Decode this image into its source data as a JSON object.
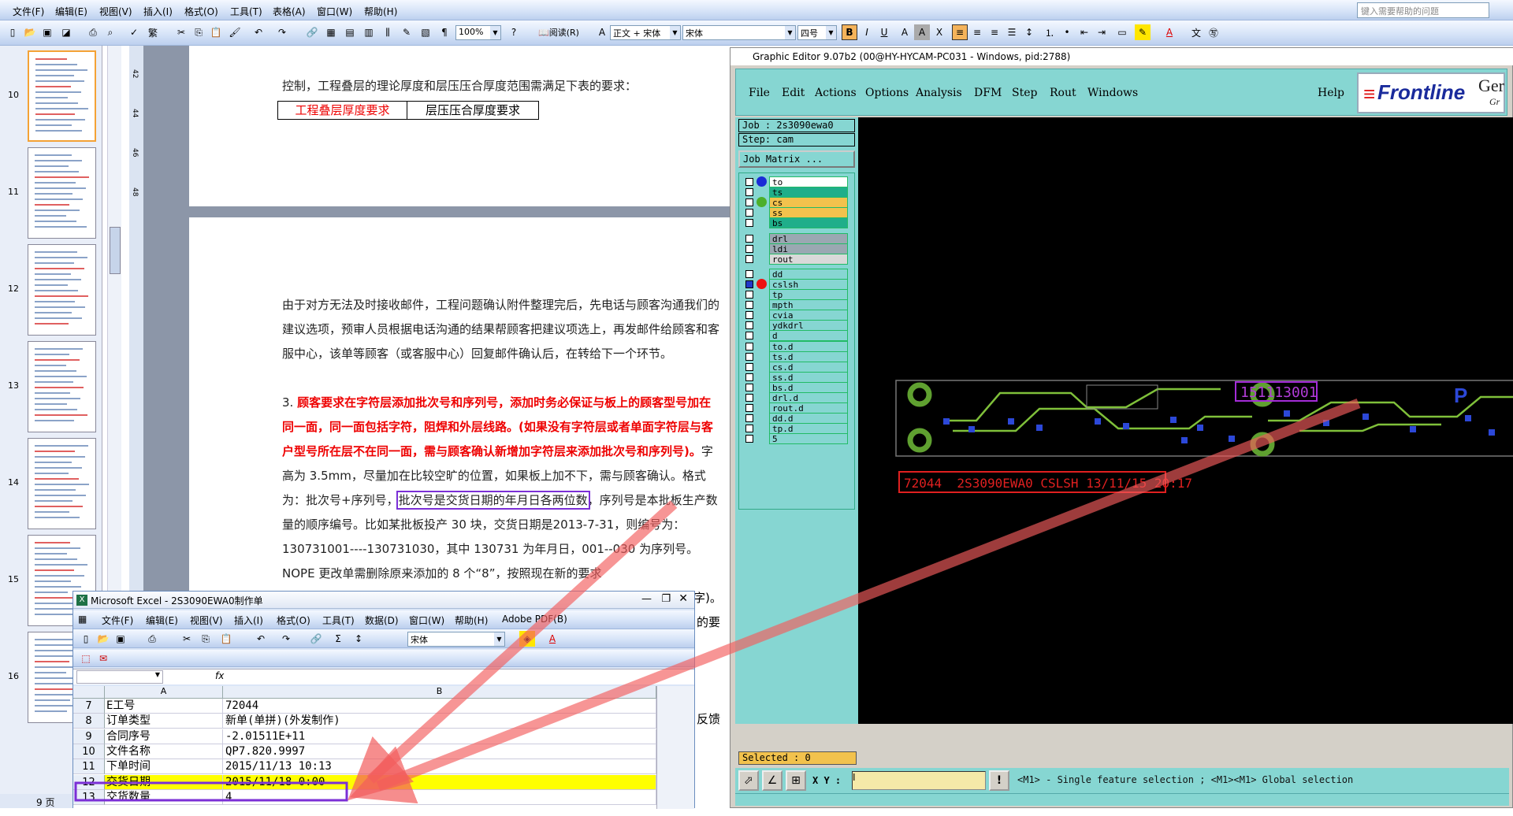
{
  "word": {
    "menu": [
      "文件(F)",
      "编辑(E)",
      "视图(V)",
      "插入(I)",
      "格式(O)",
      "工具(T)",
      "表格(A)",
      "窗口(W)",
      "帮助(H)"
    ],
    "ask_placeholder": "键入需要帮助的问题",
    "zoom": "100%",
    "read_label": "阅读(R)",
    "style": "正文 + 宋体",
    "font": "宋体",
    "size": "四号",
    "page_numbers": [
      "10",
      "11",
      "12",
      "13",
      "14",
      "15",
      "16"
    ],
    "status_pages": "9 页",
    "ruler_marks": [
      "42",
      "44",
      "46",
      "48"
    ],
    "table_left": "工程叠层厚度要求",
    "table_right": "层压压合厚度要求",
    "line_top": "控制，工程叠层的理论厚度和层压压合厚度范围需满足下表的要求：",
    "para1": "由于对方无法及时接收邮件，工程问题确认附件整理完后，先电话与顾客沟通我们的建议选项，预审人员根据电话沟通的结果帮顾客把建议项选上，再发邮件给顾客和客服中心，该单等顾客（或客服中心）回复邮件确认后，在转给下一个环节。",
    "item3_num": "3.",
    "item3_red": "顾客要求在字符层添加批次号和序列号，添加时务必保证与板上的顾客型号加在同一面，同一面包括字符，阻焊和外层线路。(如果没有字符层或者单面字符层与客户型号所在层不在同一面，需与顾客确认新增加字符层来添加批次号和序列号)。",
    "item3_rest_a": "字高为 3.5mm，尽量加在比较空旷的位置，如果板上加不下，需与顾客确认。格式为：批次号+序列号，",
    "item3_boxed": "批次号是交货日期的年月日各两位数",
    "item3_rest_b": "，序列号是本批板生产数量的顺序编号。比如某批板投产 30 块，交货日期是2013-7-31，则编号为：130731001----130731030，其中 130731 为年月日，001--030 为序列号。NOPE 更改单需删除原来添加的 8 个“8”，按照现在新的要求",
    "right_fragments": [
      "字)。",
      "的要",
      "反馈"
    ]
  },
  "genesis": {
    "title": "Graphic Editor 9.07b2 (00@HY-HYCAM-PC031 - Windows, pid:2788)",
    "menu": [
      "File",
      "Edit",
      "Actions",
      "Options",
      "Analysis",
      "DFM",
      "Step",
      "Rout",
      "Windows"
    ],
    "help": "Help",
    "logo": "Frontline",
    "logo_tail": "Ger",
    "logo_sub": "Gr",
    "job": "Job : 2s3090ewa0",
    "step": "Step: cam",
    "job_matrix": "Job Matrix ...",
    "layers": [
      {
        "name": "to",
        "bg": "#ffffff",
        "dot": "#1a2bd6"
      },
      {
        "name": "ts",
        "bg": "#1fae8a",
        "dot": ""
      },
      {
        "name": "cs",
        "bg": "#f2c24d",
        "dot": "#4caf2a"
      },
      {
        "name": "ss",
        "bg": "#f2c24d",
        "dot": ""
      },
      {
        "name": "bs",
        "bg": "#1fae8a",
        "dot": ""
      },
      {
        "name": "drl",
        "bg": "#9aa8b2",
        "dot": ""
      },
      {
        "name": "ldi",
        "bg": "#9aa8b2",
        "dot": ""
      },
      {
        "name": "rout",
        "bg": "#d9d9d9",
        "dot": ""
      },
      {
        "name": "dd",
        "bg": "#86d6d2",
        "dot": ""
      },
      {
        "name": "cslsh",
        "bg": "#86d6d2",
        "dot": "#e11"
      },
      {
        "name": "tp",
        "bg": "#86d6d2",
        "dot": ""
      },
      {
        "name": "mpth",
        "bg": "#86d6d2",
        "dot": ""
      },
      {
        "name": "cvia",
        "bg": "#86d6d2",
        "dot": ""
      },
      {
        "name": "ydkdrl",
        "bg": "#86d6d2",
        "dot": ""
      },
      {
        "name": "d",
        "bg": "#86d6d2",
        "dot": ""
      },
      {
        "name": "to.d",
        "bg": "#86d6d2",
        "dot": ""
      },
      {
        "name": "ts.d",
        "bg": "#86d6d2",
        "dot": ""
      },
      {
        "name": "cs.d",
        "bg": "#86d6d2",
        "dot": ""
      },
      {
        "name": "ss.d",
        "bg": "#86d6d2",
        "dot": ""
      },
      {
        "name": "bs.d",
        "bg": "#86d6d2",
        "dot": ""
      },
      {
        "name": "drl.d",
        "bg": "#86d6d2",
        "dot": ""
      },
      {
        "name": "rout.d",
        "bg": "#86d6d2",
        "dot": ""
      },
      {
        "name": "dd.d",
        "bg": "#86d6d2",
        "dot": ""
      },
      {
        "name": "tp.d",
        "bg": "#86d6d2",
        "dot": ""
      },
      {
        "name": "5",
        "bg": "#86d6d2",
        "dot": ""
      }
    ],
    "canvas_number": "151113001",
    "canvas_label": "72044  2S3090EWA0 CSLSH 13/11/15 20:17",
    "selected": "Selected : 0",
    "xy_label": "X Y :",
    "xy_value": "I",
    "status": "<M1> - Single feature selection ; <M1><M1> Global selection"
  },
  "excel": {
    "title": "Microsoft Excel - 2S3090EWA0制作单",
    "menu": [
      "文件(F)",
      "编辑(E)",
      "视图(V)",
      "插入(I)",
      "格式(O)",
      "工具(T)",
      "数据(D)",
      "窗口(W)",
      "帮助(H)",
      "Adobe PDF(B)"
    ],
    "font": "宋体",
    "fx": "fx",
    "col_a": "A",
    "col_b": "B",
    "rows": [
      {
        "n": "7",
        "a": "E工号",
        "b": "72044"
      },
      {
        "n": "8",
        "a": "订单类型",
        "b": "新单(单拼)(外发制作)"
      },
      {
        "n": "9",
        "a": "合同序号",
        "b": "-2.01511E+11"
      },
      {
        "n": "10",
        "a": "文件名称",
        "b": "QP7.820.9997"
      },
      {
        "n": "11",
        "a": "下单时间",
        "b": "2015/11/13 10:13"
      },
      {
        "n": "12",
        "a": "交货日期",
        "b": "2015/11/18 0:00"
      },
      {
        "n": "13",
        "a": "交货数量",
        "b": "4"
      }
    ]
  },
  "colors": {
    "annotation_purple": "#7b2fd6",
    "arrow": "#f25c5c",
    "genesis_teal": "#86d6d2"
  }
}
